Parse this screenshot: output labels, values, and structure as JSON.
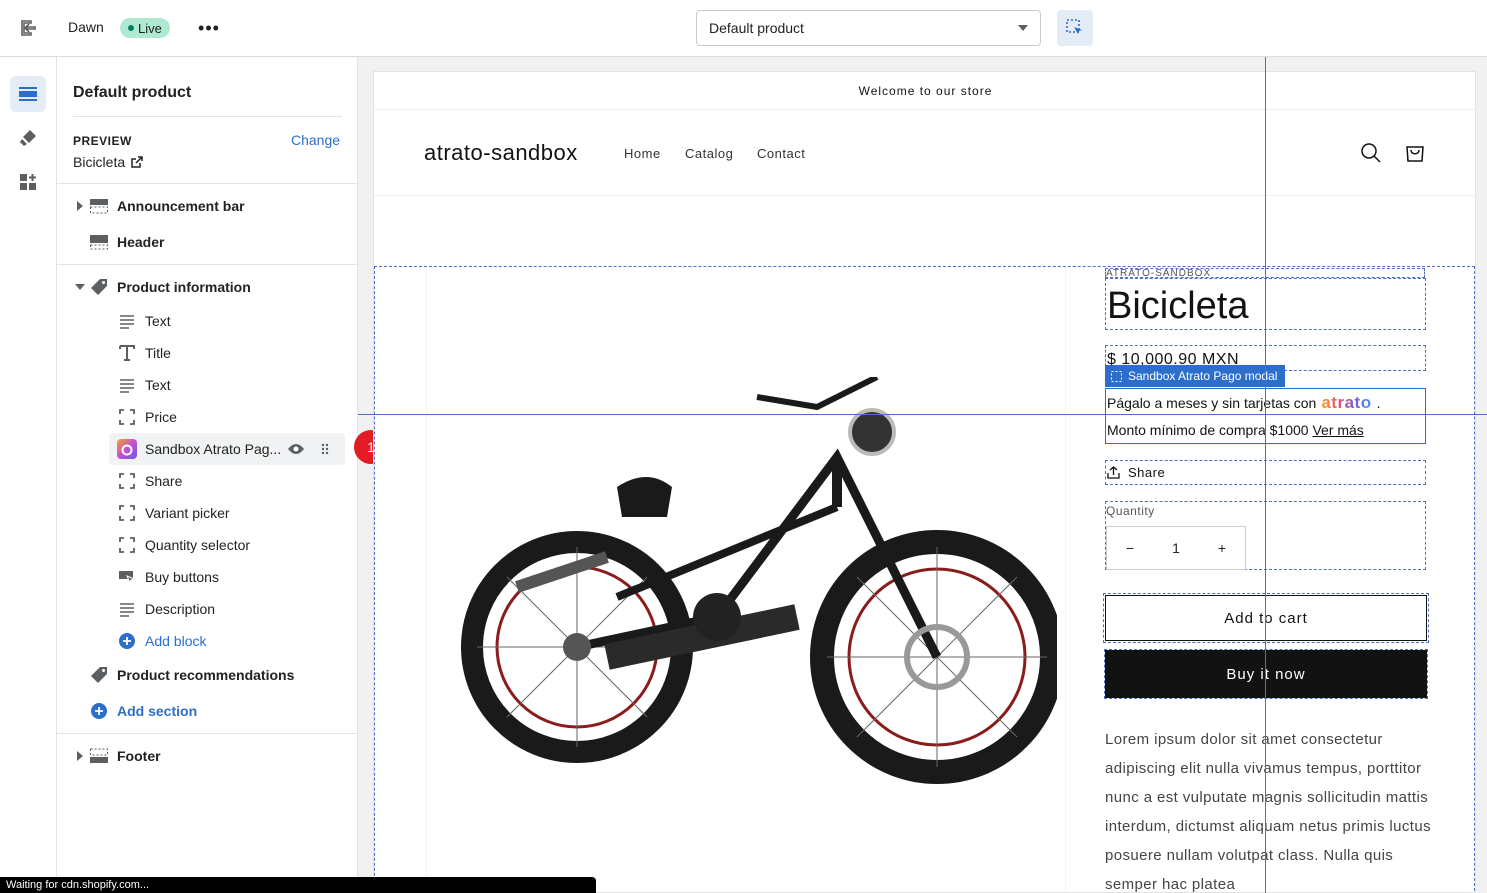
{
  "topbar": {
    "theme_name": "Dawn",
    "live_badge": "Live",
    "template_select": "Default product"
  },
  "sidebar": {
    "title": "Default product",
    "preview_label": "PREVIEW",
    "preview_change": "Change",
    "preview_value": "Bicicleta",
    "sections": {
      "announcement_bar": "Announcement bar",
      "header": "Header",
      "product_information": "Product information",
      "product_recommendations": "Product recommendations",
      "add_section": "Add section",
      "footer": "Footer"
    },
    "blocks": [
      {
        "label": "Text",
        "icon": "text-icon"
      },
      {
        "label": "Title",
        "icon": "title-icon"
      },
      {
        "label": "Text",
        "icon": "text-icon"
      },
      {
        "label": "Price",
        "icon": "dashed-square-icon"
      },
      {
        "label": "Sandbox Atrato Pag...",
        "icon": "app-icon"
      },
      {
        "label": "Share",
        "icon": "dashed-square-icon"
      },
      {
        "label": "Variant picker",
        "icon": "dashed-square-icon"
      },
      {
        "label": "Quantity selector",
        "icon": "dashed-square-icon"
      },
      {
        "label": "Buy buttons",
        "icon": "cursor-button-icon"
      },
      {
        "label": "Description",
        "icon": "text-icon"
      }
    ],
    "add_block": "Add block"
  },
  "marker_badge": "1",
  "status_bar": "Waiting for cdn.shopify.com...",
  "store": {
    "announcement": "Welcome to our store",
    "logo": "atrato-sandbox",
    "nav": [
      "Home",
      "Catalog",
      "Contact"
    ],
    "product": {
      "vendor": "ATRATO-SANDBOX",
      "title": "Bicicleta",
      "price": "$ 10,000.90 MXN",
      "block_tag": "Sandbox Atrato Pago modal",
      "atrato_text": "Págalo a meses y sin tarjetas con",
      "atrato_logo": "atrato",
      "atrato_min": "Monto mínimo de compra $1000",
      "atrato_link": "Ver más",
      "share": "Share",
      "quantity_label": "Quantity",
      "quantity_minus": "−",
      "quantity_value": "1",
      "quantity_plus": "+",
      "add_to_cart": "Add to cart",
      "buy_now": "Buy it now",
      "description": "Lorem ipsum dolor sit amet consectetur adipiscing elit nulla vivamus tempus, porttitor nunc a est vulputate magnis sollicitudin mattis interdum, dictumst aliquam netus primis luctus posuere nullam volutpat class. Nulla quis semper hac platea"
    }
  },
  "colors": {
    "accent_blue": "#2c6ecb",
    "live_green": "#aee9d1",
    "badge_red": "#e31b23"
  }
}
